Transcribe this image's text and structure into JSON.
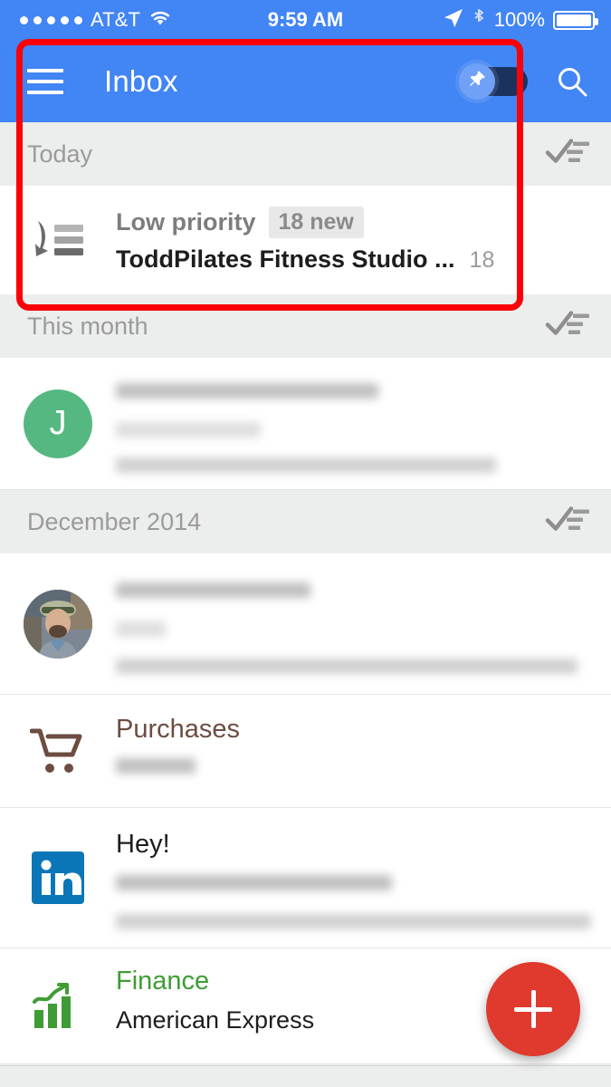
{
  "status_bar": {
    "signal_dots": 5,
    "carrier": "AT&T",
    "wifi_icon": "wifi-icon",
    "time": "9:59 AM",
    "location_icon": "location-arrow-icon",
    "bluetooth_icon": "bluetooth-icon",
    "battery_percent": "100%",
    "battery_icon": "battery-full-icon"
  },
  "app_bar": {
    "menu_icon": "hamburger-menu-icon",
    "title": "Inbox",
    "pin_toggle": {
      "icon": "pin-icon",
      "state": "off",
      "track_color": "#1b325f",
      "thumb_color": "#6fa1f7"
    },
    "search_icon": "search-icon",
    "background_color": "#4285f4"
  },
  "sections": [
    {
      "title": "Today",
      "sweep_icon": "sweep-done-icon"
    },
    {
      "title": "This month",
      "sweep_icon": "sweep-done-icon"
    },
    {
      "title": "December 2014",
      "sweep_icon": "sweep-done-icon"
    }
  ],
  "low_priority_row": {
    "icon": "low-priority-icon",
    "title": "Low priority",
    "badge": "18 new",
    "sender": "ToddPilates Fitness Studio ...",
    "count": "18"
  },
  "rows": [
    {
      "avatar_type": "letter",
      "avatar_letter": "J",
      "avatar_color": "#56b881",
      "redacted": true
    },
    {
      "avatar_type": "photo",
      "avatar_name": "contact-photo-avatar",
      "redacted": true
    }
  ],
  "bundles": [
    {
      "icon": "shopping-cart-icon",
      "title": "Purchases",
      "title_color": "#6d4c41",
      "subtitle": "",
      "redacted": true
    },
    {
      "icon": "linkedin-icon",
      "icon_color": "#0b76b7",
      "title": "Hey!",
      "title_color": "#1d1d1d",
      "subtitle": "",
      "redacted": true
    },
    {
      "icon": "finance-chart-icon",
      "icon_color": "#3f9c35",
      "title": "Finance",
      "title_color": "#3f9c35",
      "subtitle": "American Express",
      "redacted": false
    }
  ],
  "fab": {
    "icon": "plus-icon",
    "color": "#e0392d",
    "label": "Compose"
  },
  "annotation": {
    "type": "highlight-rectangle",
    "color": "#fb0007",
    "targets": "low_priority_row"
  }
}
